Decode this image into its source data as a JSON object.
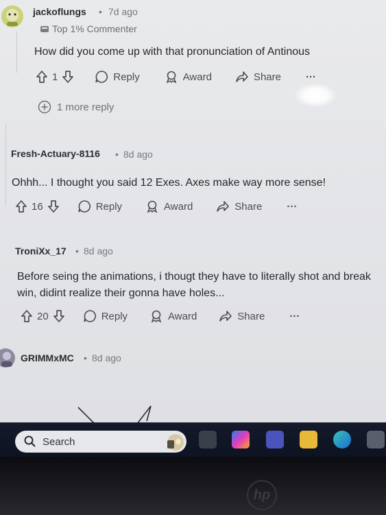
{
  "comments": [
    {
      "username": "jackoflungs",
      "timestamp": "7d ago",
      "flair": "Top 1% Commenter",
      "body": "How did you come up with that pronunciation of Antinous",
      "votes": "1",
      "reply_label": "Reply",
      "award_label": "Award",
      "share_label": "Share",
      "more_label": "···",
      "more_replies": "1 more reply"
    },
    {
      "username": "Fresh-Actuary-8116",
      "timestamp": "8d ago",
      "body": "Ohhh... I thought you said 12 Exes. Axes make way more sense!",
      "votes": "16",
      "reply_label": "Reply",
      "award_label": "Award",
      "share_label": "Share",
      "more_label": "···"
    },
    {
      "username": "TroniXx_17",
      "timestamp": "8d ago",
      "body_line1": "Before seing the animations, i thougt they have to literally shot and break",
      "body_line2": "win, didint realize their gonna have holes...",
      "votes": "20",
      "reply_label": "Reply",
      "award_label": "Award",
      "share_label": "Share",
      "more_label": "···"
    },
    {
      "username": "GRIMMxMC",
      "timestamp": "8d ago"
    }
  ],
  "separator": "•",
  "taskbar": {
    "search_label": "Search",
    "icons": [
      "search-icon",
      "file-explorer-icon",
      "copilot-icon",
      "teams-icon",
      "folder-icon",
      "edge-icon",
      "store-icon"
    ]
  },
  "bezel": {
    "logo": "hp"
  },
  "colors": {
    "screen_bg": "#e6e7ea",
    "taskbar_bg": "#141a2b"
  }
}
